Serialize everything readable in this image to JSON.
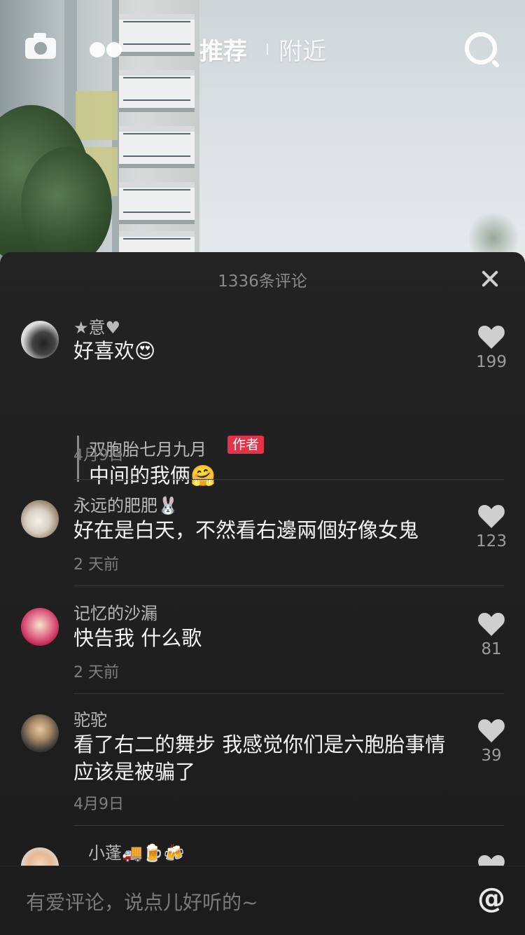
{
  "topbar": {
    "tabs": [
      {
        "label": "推荐",
        "active": true
      },
      {
        "label": "附近",
        "active": false
      }
    ],
    "icons": [
      "camera-icon",
      "dots-icon",
      "search-icon"
    ]
  },
  "sheet": {
    "title": "1336条评论"
  },
  "comments": [
    {
      "username": "★意♥",
      "text": "好喜欢",
      "emoji": "😍",
      "date": "4月9日",
      "likes": "199",
      "reply": {
        "username": "双胞胎七月九月",
        "badge": "作者",
        "text": "中间的我俩",
        "emoji": "🤗"
      }
    },
    {
      "username": "永远的肥肥🐰",
      "text": "好在是白天，不然看右邊兩個好像女鬼",
      "date": "2 天前",
      "likes": "123"
    },
    {
      "username": "记忆的沙漏",
      "text": "快告我 什么歌",
      "date": "2 天前",
      "likes": "81"
    },
    {
      "username": "驼驼",
      "text": "看了右二的舞步  我感觉你们是六胞胎事情  应该是被骗了",
      "date": "4月9日",
      "likes": "39"
    },
    {
      "username": "小蓬🚚🍺🍻"
    }
  ],
  "input": {
    "placeholder": "有爱评论，说点儿好听的~",
    "at_symbol": "@"
  },
  "colors": {
    "sheet_bg": "#1f1f1f",
    "author_badge": "#e1334a",
    "muted_text": "#7f7f7f"
  }
}
